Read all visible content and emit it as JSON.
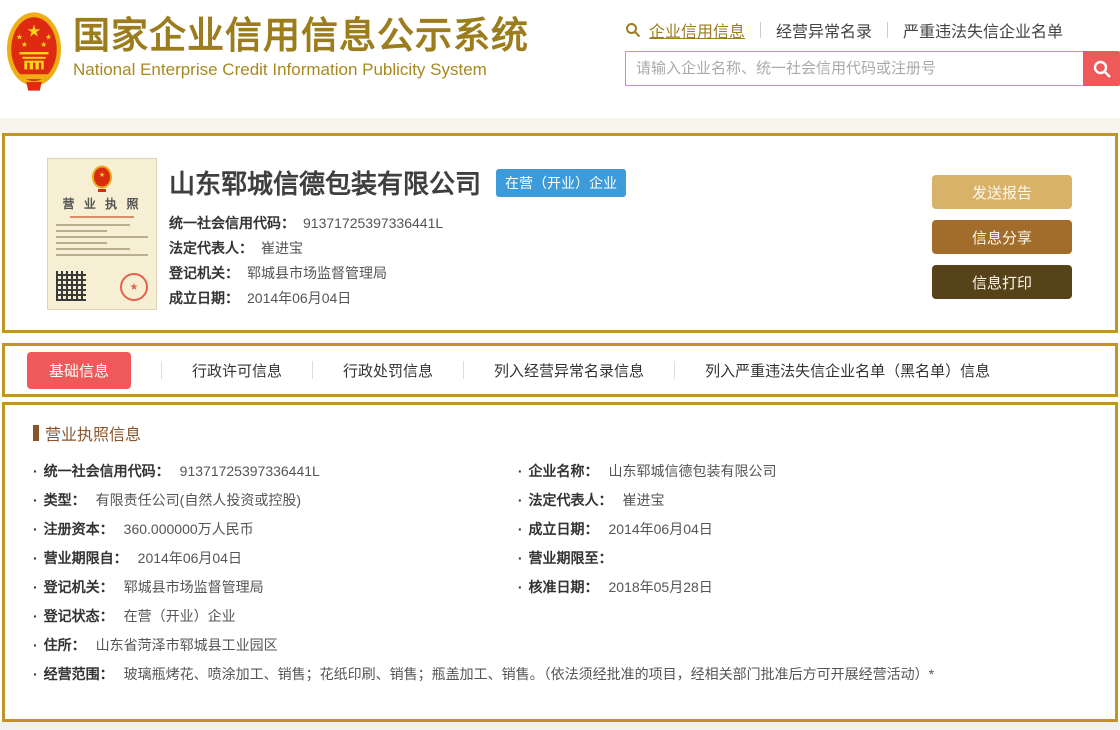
{
  "header": {
    "title": "国家企业信用信息公示系统",
    "subtitle": "National Enterprise Credit Information Publicity System",
    "nav": [
      {
        "label": "企业信用信息",
        "active": true
      },
      {
        "label": "经营异常名录",
        "active": false
      },
      {
        "label": "严重违法失信企业名单",
        "active": false
      }
    ],
    "search": {
      "placeholder": "请输入企业名称、统一社会信用代码或注册号"
    }
  },
  "company_card": {
    "license_title": "营 业 执 照",
    "name": "山东郓城信德包装有限公司",
    "status_badge": "在营（开业）企业",
    "fields": [
      {
        "label": "统一社会信用代码：",
        "value": "91371725397336441L"
      },
      {
        "label": "法定代表人：",
        "value": "崔进宝"
      },
      {
        "label": "登记机关：",
        "value": "郓城县市场监督管理局"
      },
      {
        "label": "成立日期：",
        "value": "2014年06月04日"
      }
    ],
    "buttons": [
      {
        "label": "发送报告"
      },
      {
        "label": "信息分享"
      },
      {
        "label": "信息打印"
      }
    ]
  },
  "tabs": [
    {
      "label": "基础信息",
      "active": true
    },
    {
      "label": "行政许可信息",
      "active": false
    },
    {
      "label": "行政处罚信息",
      "active": false
    },
    {
      "label": "列入经营异常名录信息",
      "active": false
    },
    {
      "label": "列入严重违法失信企业名单（黑名单）信息",
      "active": false
    }
  ],
  "detail": {
    "section_title": "营业执照信息",
    "rows": [
      {
        "label": "统一社会信用代码：",
        "value": "91371725397336441L"
      },
      {
        "label": "企业名称：",
        "value": "山东郓城信德包装有限公司"
      },
      {
        "label": "类型：",
        "value": "有限责任公司(自然人投资或控股)"
      },
      {
        "label": "法定代表人：",
        "value": "崔进宝"
      },
      {
        "label": "注册资本：",
        "value": "360.000000万人民币"
      },
      {
        "label": "成立日期：",
        "value": "2014年06月04日"
      },
      {
        "label": "营业期限自：",
        "value": "2014年06月04日"
      },
      {
        "label": "营业期限至：",
        "value": ""
      },
      {
        "label": "登记机关：",
        "value": "郓城县市场监督管理局"
      },
      {
        "label": "核准日期：",
        "value": "2018年05月28日"
      },
      {
        "label": "登记状态：",
        "value": "在营（开业）企业"
      },
      {
        "label": "住所：",
        "value": "山东省菏泽市郓城县工业园区"
      },
      {
        "label": "经营范围：",
        "value": "玻璃瓶烤花、喷涂加工、销售；花纸印刷、销售；瓶盖加工、销售。（依法须经批准的项目，经相关部门批准后方可开展经营活动）*"
      }
    ]
  },
  "colors": {
    "gold_border": "#c3932b",
    "title_gold": "#9c7d1e",
    "accent_red": "#ee5a5a",
    "badge_blue": "#3e9bda",
    "button_send": "#d9b269",
    "button_share": "#a26d2b",
    "button_print": "#57431a",
    "section_brown": "#8a5329"
  }
}
